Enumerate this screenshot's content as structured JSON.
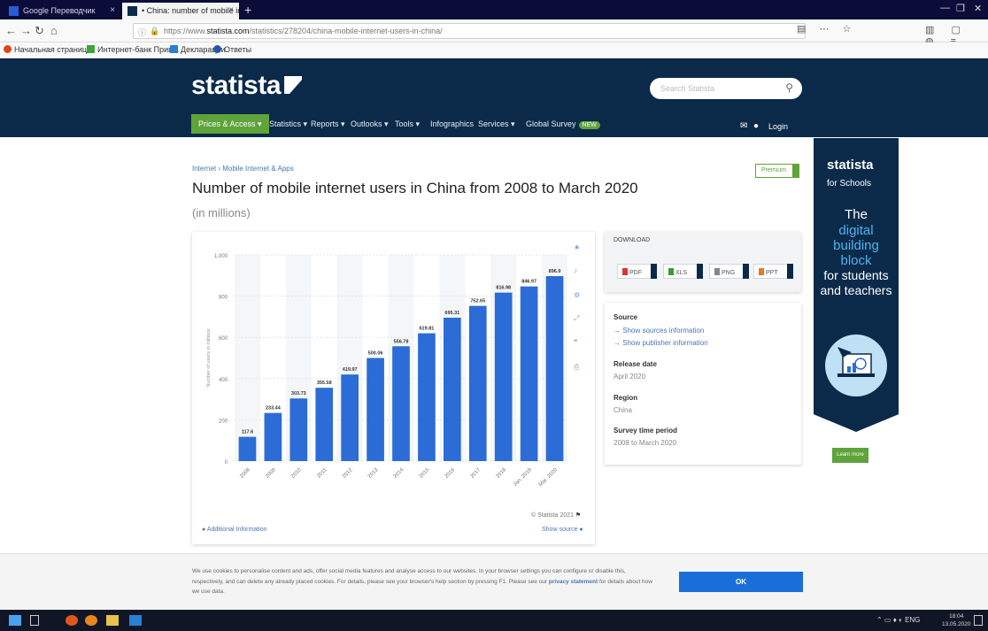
{
  "browser": {
    "tabs": [
      {
        "label": "Google Переводчик"
      },
      {
        "label": "• China: number of mobile in..."
      }
    ],
    "url_prefix": "https://www.",
    "url_domain": "statista.com",
    "url_rest": "/statistics/278204/china-mobile-internet-users-in-china/",
    "bookmarks": [
      "Начальная страница",
      "Интернет-банк Прив...",
      "Декларации",
      "Ответы"
    ]
  },
  "header": {
    "logo": "statista",
    "search_placeholder": "Search Statista",
    "nav": [
      "Prices & Access",
      "Statistics",
      "Reports",
      "Outlooks",
      "Tools",
      "Infographics",
      "Services",
      "Global Survey"
    ],
    "new_badge": "NEW",
    "login": "Login"
  },
  "page": {
    "breadcrumb": "Internet › Mobile Internet & Apps",
    "title": "Number of mobile internet users in China from 2008 to March 2020",
    "subtitle": "(in millions)",
    "premium": "Premium"
  },
  "chart_data": {
    "type": "bar",
    "categories": [
      "2008",
      "2009",
      "2010",
      "2011",
      "2012",
      "2013",
      "2014",
      "2015",
      "2016",
      "2017",
      "2018",
      "Jan. 2019",
      "Mar. 2020"
    ],
    "values": [
      117.6,
      233.44,
      303.73,
      355.58,
      419.97,
      500.06,
      556.78,
      619.81,
      695.31,
      752.65,
      816.98,
      846.97,
      896.9
    ],
    "value_labels": [
      "117.6",
      "233.44",
      "303.73",
      "355.58",
      "419.97",
      "500.06",
      "556.78",
      "619.81",
      "695.31",
      "752.65",
      "816.98",
      "846.97",
      "896.9"
    ],
    "ylabel": "Number of users in millions",
    "yticks": [
      "0",
      "200",
      "400",
      "600",
      "800",
      "1,000"
    ],
    "ylim": [
      0,
      1000
    ],
    "bar_color": "#2b6cd6",
    "grid": true
  },
  "chart_footer": {
    "copyright": "© Statista 2021",
    "additional_info": "Additional Information",
    "show_source": "Show source"
  },
  "download": {
    "title": "DOWNLOAD",
    "formats": [
      "PDF",
      "XLS",
      "PNG",
      "PPT"
    ]
  },
  "info": {
    "source_label": "Source",
    "source_links": [
      "Show sources information",
      "Show publisher information"
    ],
    "release_label": "Release date",
    "release_value": "April 2020",
    "region_label": "Region",
    "region_value": "China",
    "period_label": "Survey time period",
    "period_value": "2008 to March 2020"
  },
  "ad": {
    "logo": "statista",
    "schools": "for Schools",
    "the": "The",
    "lines": [
      "digital",
      "building",
      "block",
      "for students",
      "and teachers"
    ],
    "button": "Learn more"
  },
  "cookie": {
    "text": "We use cookies to personalise content and ads, offer social media features and analyse access to our websites. In your browser settings you can configure or disable this, respectively, and can delete any already placed cookies. For details, please see your browser's help section by pressing F1. Please see our",
    "privacy": "privacy statement",
    "text_end": "for details about how we use data.",
    "ok": "OK"
  },
  "taskbar": {
    "time": "18:04",
    "date": "13.05.2020"
  }
}
